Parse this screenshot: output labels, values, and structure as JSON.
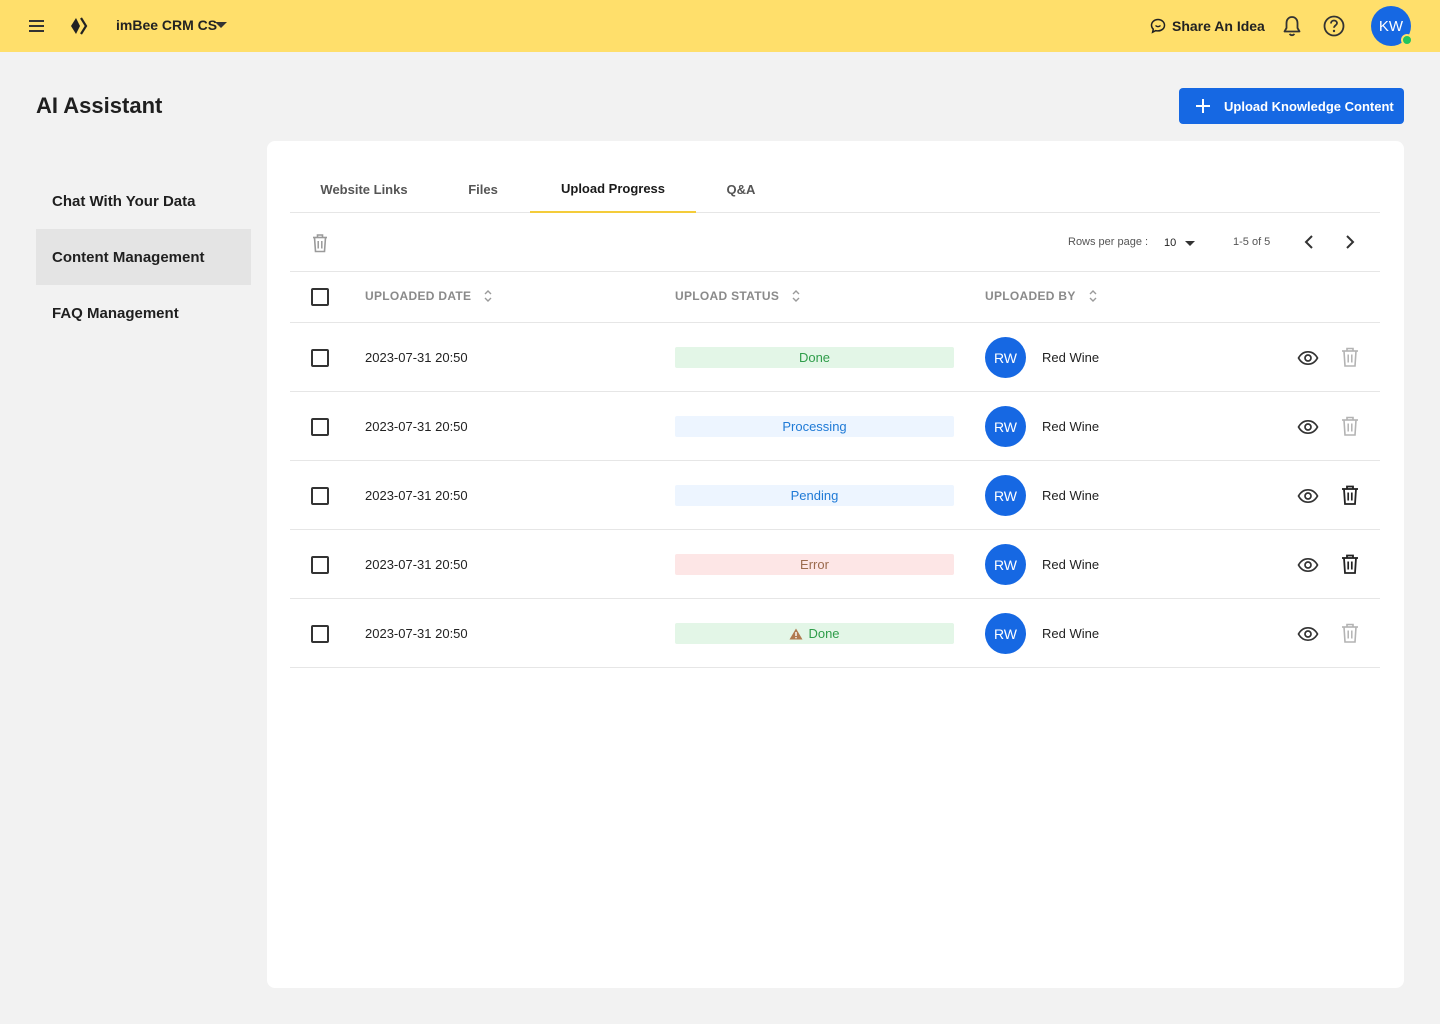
{
  "header": {
    "app_name": "imBee CRM CS",
    "share_label": "Share An Idea",
    "avatar_initials": "KW"
  },
  "page": {
    "title": "AI Assistant",
    "upload_button_label": "Upload Knowledge Content"
  },
  "sidebar": {
    "items": [
      {
        "label": "Chat With Your Data",
        "active": false
      },
      {
        "label": "Content Management",
        "active": true
      },
      {
        "label": "FAQ Management",
        "active": false
      }
    ]
  },
  "tabs": [
    {
      "label": "Website Links",
      "active": false
    },
    {
      "label": "Files",
      "active": false
    },
    {
      "label": "Upload Progress",
      "active": true
    },
    {
      "label": "Q&A",
      "active": false
    }
  ],
  "pagination": {
    "rows_per_page_label": "Rows per page :",
    "rows_per_page_value": "10",
    "range": "1-5 of 5"
  },
  "table": {
    "columns": [
      "UPLOADED DATE",
      "UPLOAD STATUS",
      "UPLOADED BY"
    ],
    "rows": [
      {
        "date": "2023-07-31 20:50",
        "status": "Done",
        "status_type": "done",
        "warning": false,
        "avatar": "RW",
        "uploaded_by": "Red Wine",
        "delete_enabled": false
      },
      {
        "date": "2023-07-31 20:50",
        "status": "Processing",
        "status_type": "processing",
        "warning": false,
        "avatar": "RW",
        "uploaded_by": "Red Wine",
        "delete_enabled": false
      },
      {
        "date": "2023-07-31 20:50",
        "status": "Pending",
        "status_type": "pending",
        "warning": false,
        "avatar": "RW",
        "uploaded_by": "Red Wine",
        "delete_enabled": true
      },
      {
        "date": "2023-07-31 20:50",
        "status": "Error",
        "status_type": "error",
        "warning": false,
        "avatar": "RW",
        "uploaded_by": "Red Wine",
        "delete_enabled": true
      },
      {
        "date": "2023-07-31 20:50",
        "status": "Done",
        "status_type": "done",
        "warning": true,
        "avatar": "RW",
        "uploaded_by": "Red Wine",
        "delete_enabled": false
      }
    ]
  },
  "colors": {
    "topbar": "#ffdf6b",
    "primary": "#1668e3",
    "tab_indicator": "#f4cc3a",
    "online": "#22c55e"
  },
  "icons": [
    "menu-icon",
    "logo-icon",
    "chevron-down-icon",
    "chat-bubble-icon",
    "bell-icon",
    "help-icon",
    "plus-icon",
    "trash-icon",
    "sort-icon",
    "eye-icon",
    "chevron-left-icon",
    "chevron-right-icon",
    "warning-icon"
  ]
}
